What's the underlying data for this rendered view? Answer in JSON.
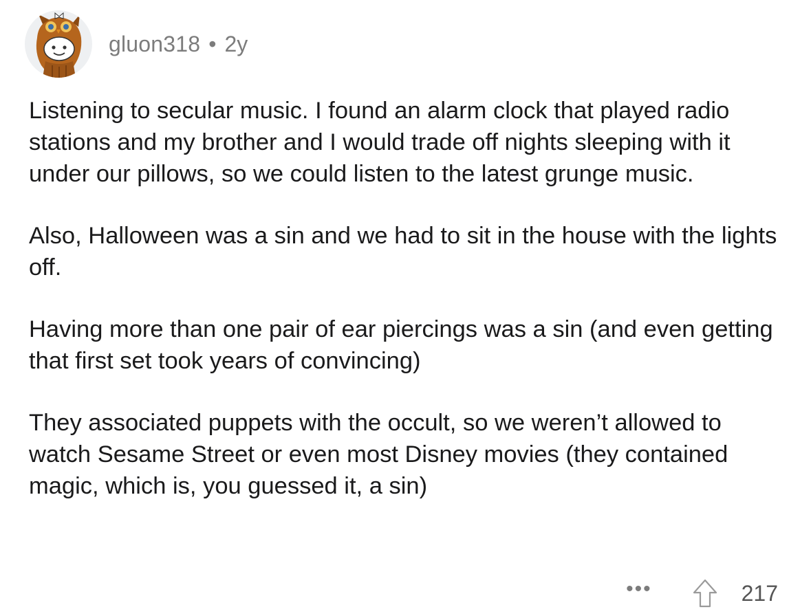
{
  "comment": {
    "author": "gluon318",
    "separator": "•",
    "age": "2y",
    "avatar_icon": "owl-costume-snoo-avatar",
    "paragraphs": [
      "Listening to secular music. I found an alarm clock that played radio stations and my brother and I would trade off nights sleeping with it under our pillows, so we could listen to the latest grunge music.",
      "Also, Halloween was a sin and we had to sit in the house with the lights off.",
      "Having more than one pair of ear piercings was a sin (and even getting that first set took years of convincing)",
      "They associated puppets with the occult, so we weren’t allowed to watch Sesame Street or even most Disney movies (they contained magic, which is, you guessed it, a sin)"
    ],
    "more_label": "•••",
    "upvote_icon": "upvote-arrow-icon",
    "score": "217"
  },
  "colors": {
    "text": "#1a1a1b",
    "meta": "#7c7c7c",
    "avatar_bg": "#eef0f2",
    "owl_brown": "#b5651d"
  }
}
